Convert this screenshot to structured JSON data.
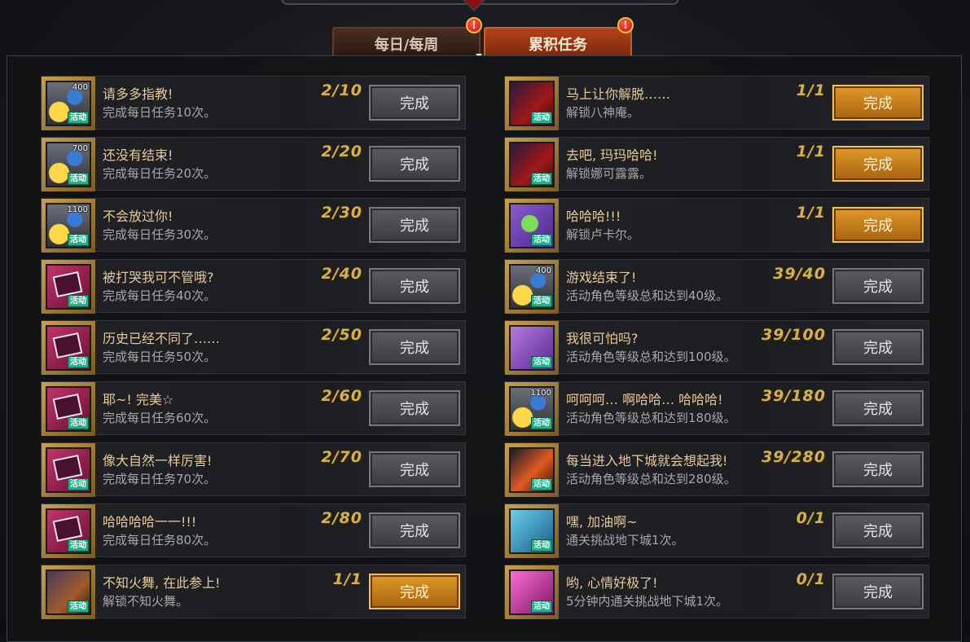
{
  "tabs": [
    {
      "label": "每日/每周",
      "active": false
    },
    {
      "label": "累积任务",
      "active": true
    }
  ],
  "alert_mark": "!",
  "button_label": "完成",
  "badge_label": "活动",
  "left_tasks": [
    {
      "title": "请多多指教!",
      "desc": "完成每日任务10次。",
      "progress": "2/10",
      "icon": "coin-reward-icon",
      "icon_num": "400",
      "ready": false
    },
    {
      "title": "还没有结束!",
      "desc": "完成每日任务20次。",
      "progress": "2/20",
      "icon": "coin-reward-icon",
      "icon_num": "700",
      "ready": false
    },
    {
      "title": "不会放过你!",
      "desc": "完成每日任务30次。",
      "progress": "2/30",
      "icon": "coin-reward-icon",
      "icon_num": "1100",
      "ready": false
    },
    {
      "title": "被打哭我可不管哦?",
      "desc": "完成每日任务40次。",
      "progress": "2/40",
      "icon": "card-reward-icon",
      "icon_num": "",
      "ready": false
    },
    {
      "title": "历史已经不同了……",
      "desc": "完成每日任务50次。",
      "progress": "2/50",
      "icon": "card-reward-icon",
      "icon_num": "",
      "ready": false
    },
    {
      "title": "耶~! 完美☆",
      "desc": "完成每日任务60次。",
      "progress": "2/60",
      "icon": "card-reward-icon",
      "icon_num": "",
      "ready": false
    },
    {
      "title": "像大自然一样厉害!",
      "desc": "完成每日任务70次。",
      "progress": "2/70",
      "icon": "card-reward-icon",
      "icon_num": "",
      "ready": false
    },
    {
      "title": "哈哈哈哈一一!!!",
      "desc": "完成每日任务80次。",
      "progress": "2/80",
      "icon": "card-reward-icon",
      "icon_num": "",
      "ready": false
    },
    {
      "title": "不知火舞, 在此参上!",
      "desc": "解锁不知火舞。",
      "progress": "1/1",
      "icon": "character-unlock-icon",
      "icon_num": "",
      "ready": true
    }
  ],
  "right_tasks": [
    {
      "title": "马上让你解脱……",
      "desc": "解锁八神庵。",
      "progress": "1/1",
      "icon": "character-unlock-icon",
      "icon_num": "",
      "ready": true
    },
    {
      "title": "去吧, 玛玛哈哈!",
      "desc": "解锁娜可露露。",
      "progress": "1/1",
      "icon": "character-unlock-icon",
      "icon_num": "",
      "ready": true
    },
    {
      "title": "哈哈哈!!!",
      "desc": "解锁卢卡尔。",
      "progress": "1/1",
      "icon": "gift-box-icon",
      "icon_num": "",
      "ready": true
    },
    {
      "title": "游戏结束了!",
      "desc": "活动角色等级总和达到40级。",
      "progress": "39/40",
      "icon": "coin-reward-icon",
      "icon_num": "400",
      "ready": false
    },
    {
      "title": "我很可怕吗?",
      "desc": "活动角色等级总和达到100级。",
      "progress": "39/100",
      "icon": "purple-item-icon",
      "icon_num": "",
      "ready": false
    },
    {
      "title": "呵呵呵… 啊哈哈… 哈哈哈!",
      "desc": "活动角色等级总和达到180级。",
      "progress": "39/180",
      "icon": "coin-reward-icon",
      "icon_num": "1100",
      "ready": false
    },
    {
      "title": "每当进入地下城就会想起我!",
      "desc": "活动角色等级总和达到280级。",
      "progress": "39/280",
      "icon": "sword-icon",
      "icon_num": "",
      "ready": false
    },
    {
      "title": "嘿, 加油啊~",
      "desc": "通关挑战地下城1次。",
      "progress": "0/1",
      "icon": "chest-icon",
      "icon_num": "",
      "ready": false
    },
    {
      "title": "哟, 心情好极了!",
      "desc": "5分钟内通关挑战地下城1次。",
      "progress": "0/1",
      "icon": "pink-item-icon",
      "icon_num": "",
      "ready": false
    }
  ]
}
